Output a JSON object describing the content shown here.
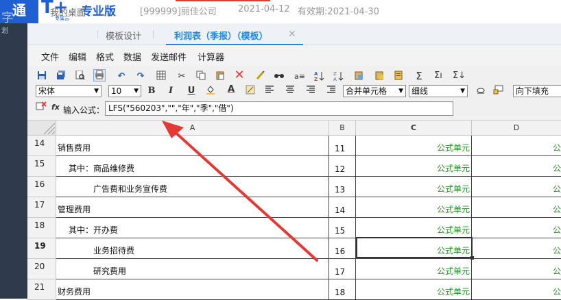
{
  "header": {
    "logo_text": "通",
    "logo_mark": "T+",
    "logo_subtitle": "专属云",
    "product_name": "专业版",
    "company": "[999999]丽佳公司",
    "date": "2021-04-12",
    "validity": "有效期:2021-04-30"
  },
  "sidebar": {
    "glyph": "字",
    "glyph2": "划"
  },
  "tabs": [
    {
      "label": "我的桌面"
    },
    {
      "label": "模板设计"
    },
    {
      "label": "利润表（季报）（模板）",
      "active": true
    }
  ],
  "tab_close_glyph": "✕",
  "menu": [
    "文件",
    "编辑",
    "格式",
    "数据",
    "发送邮件",
    "计算器"
  ],
  "format_bar": {
    "font_family": "宋体",
    "font_size": "10",
    "bold": "B",
    "italic": "I",
    "underline": "U",
    "font_color": "A",
    "merge": "合并单元格",
    "border": "细线",
    "fill_down": "向下填充"
  },
  "formula_bar": {
    "label": "输入公式：",
    "value": "LFS(\"560203\",\"\",\"年\",\"季\",\"借\")",
    "fx": "fx"
  },
  "columns": [
    "A",
    "B",
    "C",
    "D"
  ],
  "rows": [
    {
      "num": "14",
      "a": "销售费用",
      "b": "11",
      "c": "公式单元",
      "d": "公",
      "indent": 0
    },
    {
      "num": "15",
      "a": "其中：商品维修费",
      "b": "12",
      "c": "公式单元",
      "d": "公",
      "indent": 1
    },
    {
      "num": "16",
      "a": "广告费和业务宣传费",
      "b": "13",
      "c": "公式单元",
      "d": "公",
      "indent": 2
    },
    {
      "num": "17",
      "a": "管理费用",
      "b": "14",
      "c": "公式单元",
      "d": "公",
      "indent": 0
    },
    {
      "num": "18",
      "a": "其中：开办费",
      "b": "15",
      "c": "公式单元",
      "d": "公",
      "indent": 1
    },
    {
      "num": "19",
      "a": "业务招待费",
      "b": "16",
      "c": "公式单元",
      "d": "公",
      "indent": 2
    },
    {
      "num": "20",
      "a": "研究费用",
      "b": "17",
      "c": "公式单元",
      "d": "公",
      "indent": 2
    },
    {
      "num": "21",
      "a": "财务费用",
      "b": "18",
      "c": "公式单元",
      "d": "公",
      "indent": 0
    }
  ],
  "colors": {
    "accent": "#1f5fd1",
    "formula_cell": "#2e8b2e",
    "arrow": "#e53935"
  }
}
